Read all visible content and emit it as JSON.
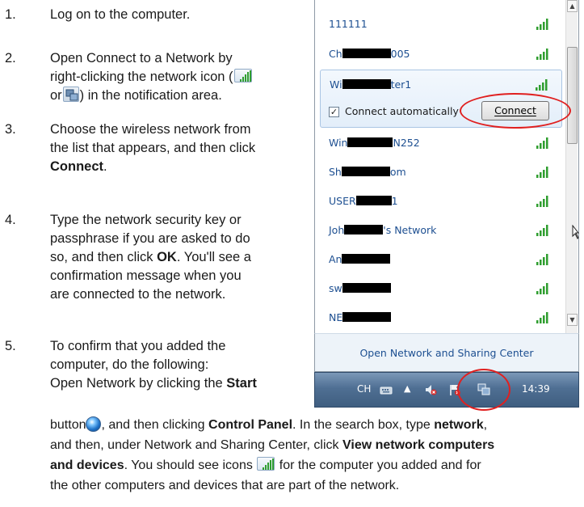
{
  "steps": [
    {
      "num": "1.",
      "text": "Log on to the computer."
    },
    {
      "num": "2.",
      "line1": "Open Connect to a Network by",
      "line2a": "right-clicking the network icon (",
      "line3a": "or",
      "line3b": ") in the notification area."
    },
    {
      "num": "3.",
      "line1": "Choose the wireless network from",
      "line2": "the list that appears, and then click",
      "line3b": "Connect",
      "line3c": "."
    },
    {
      "num": "4.",
      "line1": "Type the network security key or",
      "line2": "passphrase if you are asked to do",
      "line3a": "so, and then click ",
      "line3b": "OK",
      "line3c": ". You'll see a",
      "line4": "confirmation message when you",
      "line5": "are connected to the network."
    },
    {
      "num": "5.",
      "line1": "To confirm that you added the",
      "line2": "computer, do the following:",
      "line3a": "Open Network by clicking the ",
      "line3b": "Start",
      "l4a": "button",
      "l4b": ", and then clicking ",
      "l4c": "Control Panel",
      "l4d": ". In the search box, type ",
      "l4e": "network",
      "l4f": ",",
      "l5a": "and then, under Network and Sharing Center, click ",
      "l5b": "View network computers",
      "l6a": "and devices",
      "l6b": ". You should see icons ",
      "l6c": " for the computer you added and for",
      "l7": "the other computers and devices that are part of the network."
    }
  ],
  "panel": {
    "networks": [
      {
        "prefix": "111111",
        "suffix": ""
      },
      {
        "prefix": "Ch",
        "suffix": "005"
      },
      {
        "prefix": "Wi",
        "suffix": "ter1"
      },
      {
        "prefix": "Win",
        "suffix": "N252"
      },
      {
        "prefix": "Sh",
        "suffix": "om"
      },
      {
        "prefix": "USER",
        "suffix": "1"
      },
      {
        "prefix": "Joh",
        "suffix": "'s Network"
      },
      {
        "prefix": "An",
        "suffix": ""
      },
      {
        "prefix": "sw",
        "suffix": ""
      },
      {
        "prefix": "NE",
        "suffix": ""
      }
    ],
    "connect_automatically": "Connect automatically",
    "connect_button": "Connect",
    "footer_link": "Open Network and Sharing Center"
  },
  "taskbar": {
    "language": "CH",
    "time": "14:39"
  },
  "colors": {
    "link": "#1d4f91",
    "highlight_ring": "#e02020",
    "signal": "#2f9e2f"
  }
}
